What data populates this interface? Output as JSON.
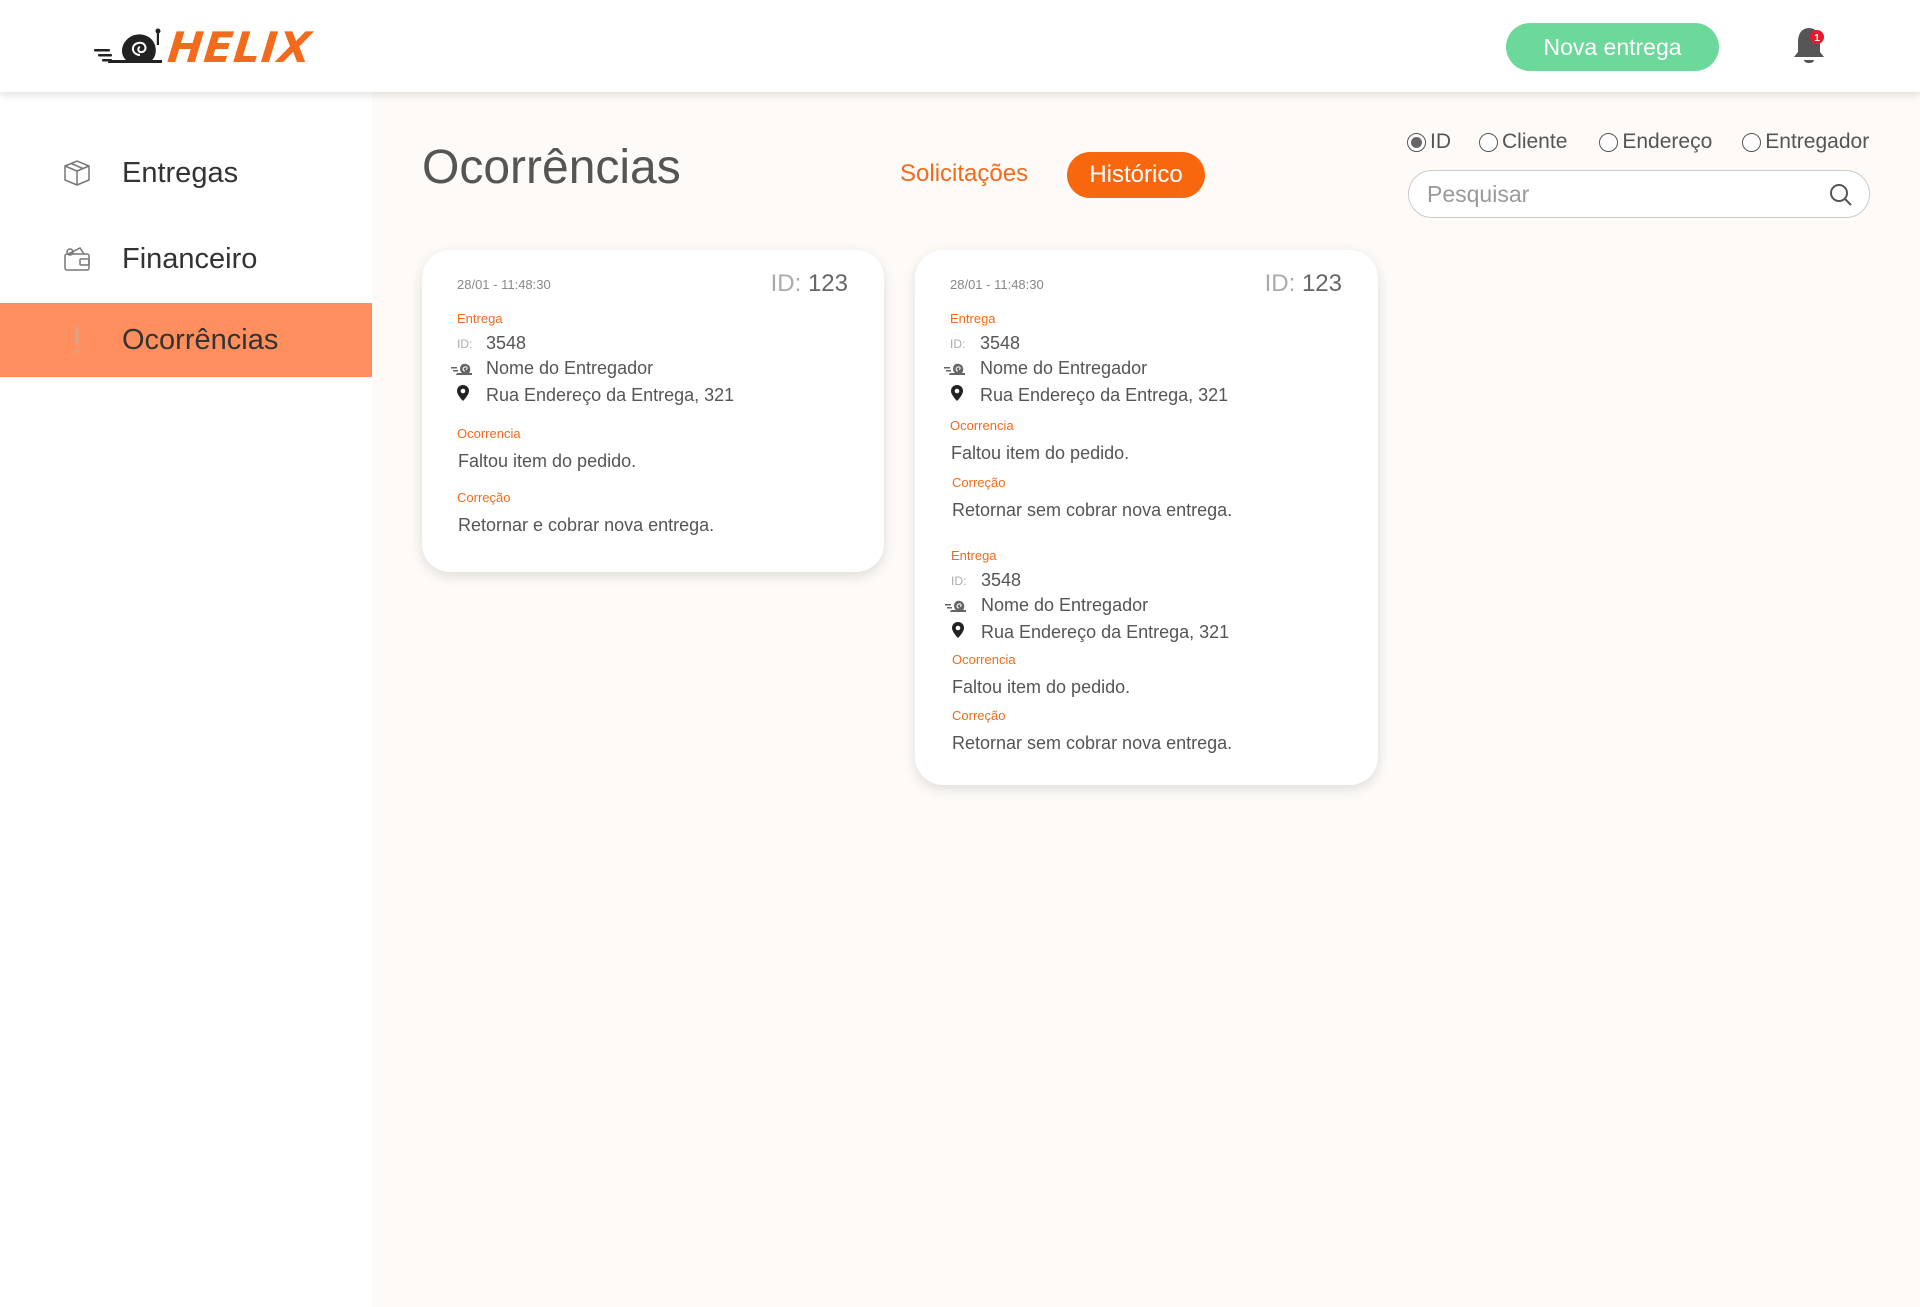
{
  "header": {
    "logo_text": "HELIX",
    "new_delivery_label": "Nova entrega",
    "notification_count": "1"
  },
  "sidebar": {
    "items": [
      {
        "label": "Entregas",
        "icon": "box-icon"
      },
      {
        "label": "Financeiro",
        "icon": "wallet-icon"
      },
      {
        "label": "Ocorrências",
        "icon": "exclamation-icon",
        "active": true
      }
    ]
  },
  "main": {
    "title": "Ocorrências",
    "tabs": [
      {
        "label": "Solicitações",
        "active": false
      },
      {
        "label": "Histórico",
        "active": true
      }
    ],
    "filters": [
      {
        "label": "ID",
        "checked": true
      },
      {
        "label": "Cliente",
        "checked": false
      },
      {
        "label": "Endereço",
        "checked": false
      },
      {
        "label": "Entregador",
        "checked": false
      }
    ],
    "search_placeholder": "Pesquisar"
  },
  "cards": [
    {
      "date": "28/01 - 11:48:30",
      "id_label": "ID:",
      "id_value": "123",
      "entries": [
        {
          "entrega_label": "Entrega",
          "id_small": "ID:",
          "entrega_id": "3548",
          "driver": "Nome do Entregador",
          "address": "Rua Endereço da Entrega, 321",
          "ocorrencia_label": "Ocorrencia",
          "ocorrencia": "Faltou item do pedido.",
          "correcao_label": "Correção",
          "correcao": "Retornar e cobrar nova entrega."
        }
      ]
    },
    {
      "date": "28/01 - 11:48:30",
      "id_label": "ID:",
      "id_value": "123",
      "entries": [
        {
          "entrega_label": "Entrega",
          "id_small": "ID:",
          "entrega_id": "3548",
          "driver": "Nome do Entregador",
          "address": "Rua Endereço da Entrega, 321",
          "ocorrencia_label": "Ocorrencia",
          "ocorrencia": "Faltou item do pedido.",
          "correcao_label": "Correção",
          "correcao": "Retornar sem cobrar nova entrega."
        },
        {
          "entrega_label": "Entrega",
          "id_small": "ID:",
          "entrega_id": "3548",
          "driver": "Nome do Entregador",
          "address": "Rua Endereço da Entrega, 321",
          "ocorrencia_label": "Ocorrencia",
          "ocorrencia": "Faltou item do pedido.",
          "correcao_label": "Correção",
          "correcao": "Retornar sem cobrar nova entrega."
        }
      ]
    }
  ],
  "colors": {
    "accent": "#f26a1b",
    "active_nav": "#ff8f5e",
    "primary_button": "#6cd899",
    "tab_active": "#f8660d",
    "badge": "#e8192c"
  }
}
